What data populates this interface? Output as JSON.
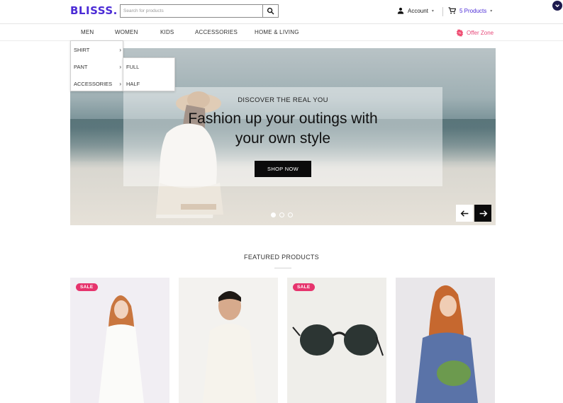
{
  "header": {
    "logo": "BLISSS",
    "logo_dot": ".",
    "search_placeholder": "Search for products",
    "account_label": "Account",
    "cart_label": "5 Products"
  },
  "nav": {
    "items": [
      "MEN",
      "WOMEN",
      "KIDS",
      "ACCESSORIES",
      "HOME & LIVING"
    ],
    "offer": "Offer Zone"
  },
  "dropdown": {
    "level1": [
      "SHIRT",
      "PANT",
      "ACCESSORIES"
    ],
    "level2": [
      "FULL",
      "HALF"
    ]
  },
  "hero": {
    "kicker": "DISCOVER THE REAL YOU",
    "headline_line1": "Fashion up your outings with",
    "headline_line2": "your own style",
    "cta": "SHOP NOW",
    "slides": 3,
    "active_slide": 1
  },
  "featured": {
    "title": "FEATURED PRODUCTS",
    "products": [
      {
        "badge": "SALE",
        "image": "woman-white-dress"
      },
      {
        "badge": "",
        "image": "man-white-sweater"
      },
      {
        "badge": "SALE",
        "image": "sunglasses"
      },
      {
        "badge": "",
        "image": "woman-blue-sweater-plant"
      }
    ]
  },
  "colors": {
    "brand": "#4b2bd6",
    "offer": "#e74a7a",
    "sale_badge": "#e6346d",
    "dark": "#0b0b0b"
  },
  "icons": [
    "search-icon",
    "user-icon",
    "cart-icon",
    "chevron-down-icon",
    "offer-icon",
    "arrow-left-icon",
    "arrow-right-icon"
  ]
}
